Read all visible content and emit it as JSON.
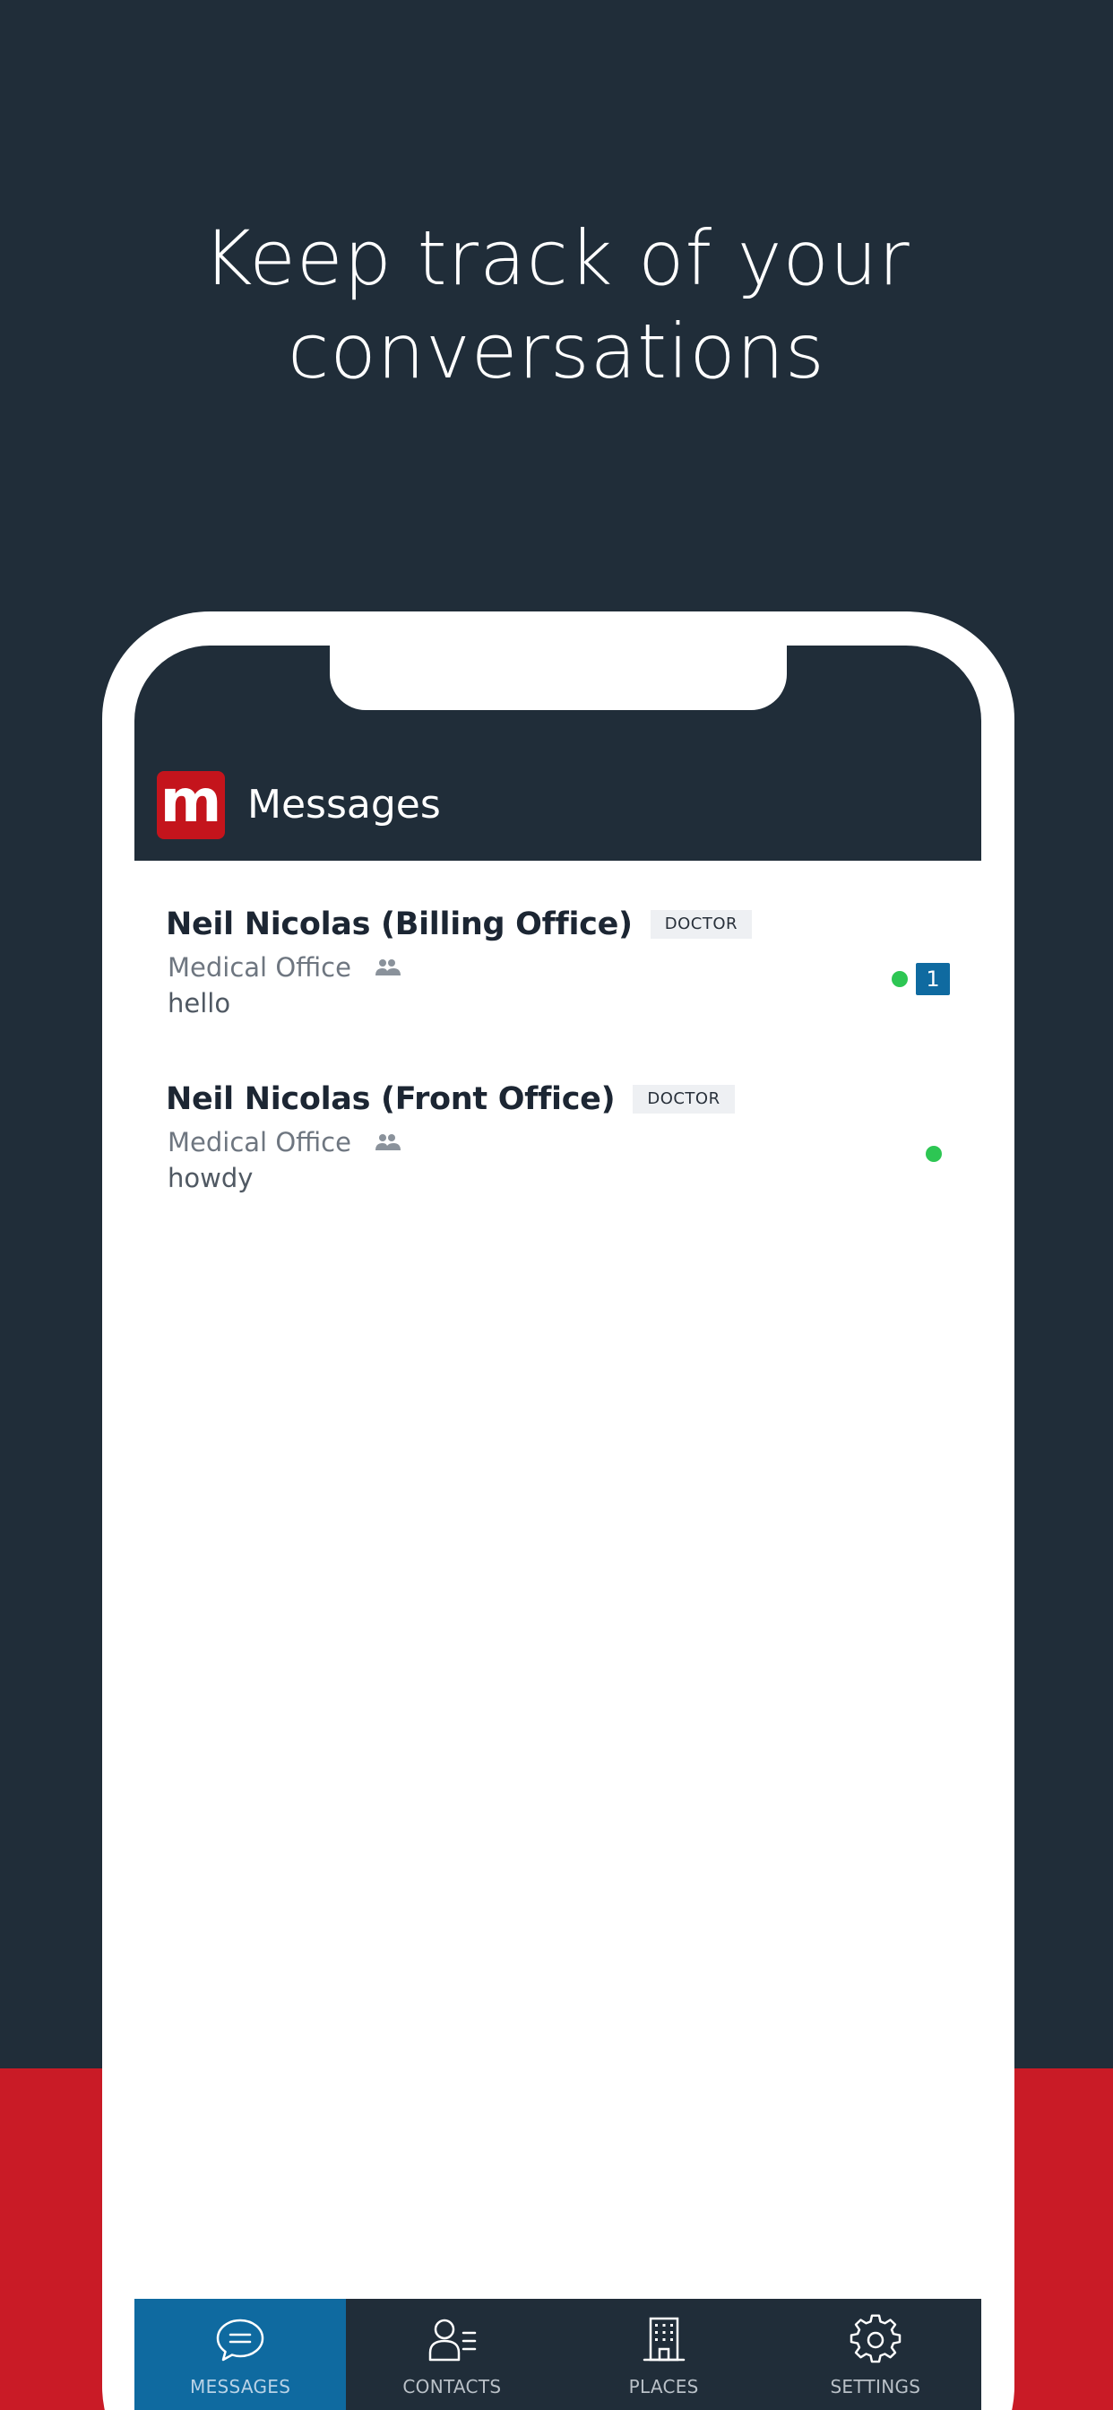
{
  "headline": {
    "line1": "Keep track of your",
    "line2": "conversations"
  },
  "app": {
    "logo_letter": "m",
    "title": "Messages"
  },
  "conversations": [
    {
      "name": "Neil Nicolas (Billing Office)",
      "role": "DOCTOR",
      "place": "Medical Office",
      "preview": "hello",
      "online": true,
      "unread": "1"
    },
    {
      "name": "Neil Nicolas (Front Office)",
      "role": "DOCTOR",
      "place": "Medical Office",
      "preview": "howdy",
      "online": true
    }
  ],
  "tabbar": {
    "tabs": [
      {
        "label": "MESSAGES",
        "icon": "chat-bubble-icon",
        "active": true
      },
      {
        "label": "CONTACTS",
        "icon": "contacts-icon",
        "active": false
      },
      {
        "label": "PLACES",
        "icon": "building-icon",
        "active": false
      },
      {
        "label": "SETTINGS",
        "icon": "gear-icon",
        "active": false
      }
    ]
  },
  "colors": {
    "background": "#202d39",
    "accent_red": "#c91b26",
    "active_tab": "#0f6aa0",
    "online": "#2dc653"
  }
}
